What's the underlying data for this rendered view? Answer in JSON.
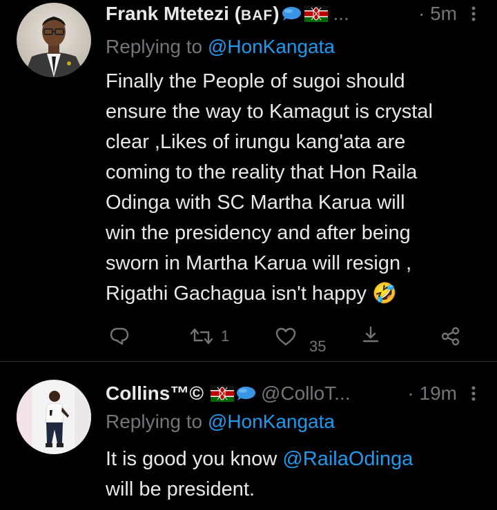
{
  "tweets": [
    {
      "author_name": "Frank Mtetezi (",
      "author_tag": "BAF",
      "author_close": ")",
      "ellipsis": "...",
      "time": "· 5m",
      "replying_prefix": "Replying to ",
      "replying_handle": "@HonKangata",
      "body_lines": [
        "Finally the People of sugoi should",
        "ensure the way to Kamagut is crystal",
        "clear ,Likes of irungu kang'ata are",
        "coming to the reality that Hon Raila",
        "Odinga with SC Martha Karua will",
        "win the presidency and after being",
        "sworn in Martha Karua will resign ,",
        "Rigathi Gachagua isn't happy"
      ],
      "emoji": "🤣",
      "retweets": "1",
      "likes": "35"
    },
    {
      "author_name": "Collins™©",
      "handle": "@ColloT...",
      "time": "· 19m",
      "replying_prefix": "Replying to ",
      "replying_handle": "@HonKangata",
      "body_prefix": "It is good you know ",
      "body_mention": "@RailaOdinga",
      "body_suffix": "will be president."
    }
  ],
  "colors": {
    "background": "#000000",
    "text": "#e7e9ea",
    "secondary": "#71767b",
    "link": "#1d9bf0"
  },
  "icons": [
    "speech-bubble-icon",
    "kenya-flag-icon",
    "more-icon",
    "reply-icon",
    "retweet-icon",
    "like-icon",
    "share-icon",
    "action-share-icon"
  ]
}
